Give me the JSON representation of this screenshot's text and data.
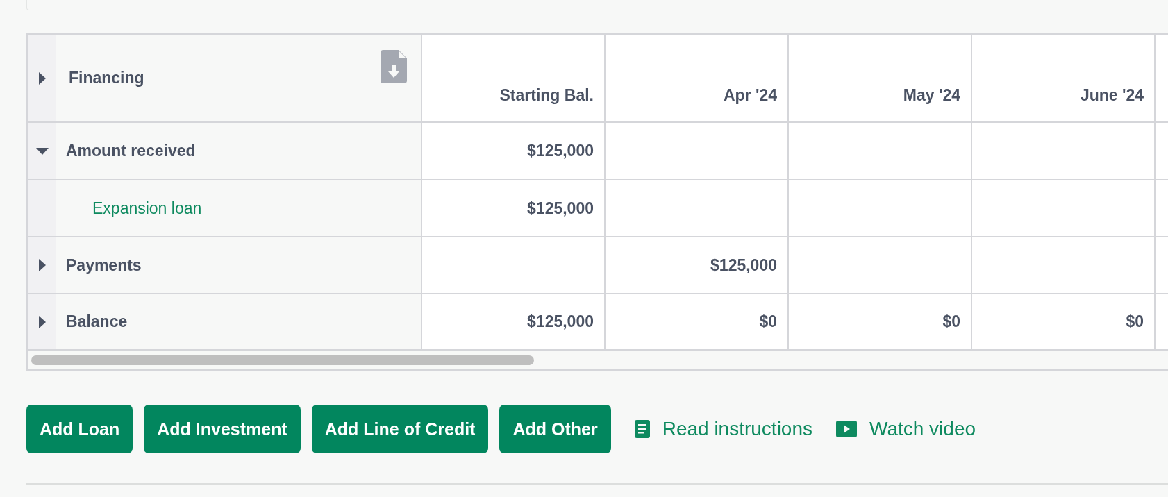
{
  "table": {
    "header": {
      "label": "Financing",
      "expanded": false,
      "columns": [
        "Starting Bal.",
        "Apr '24",
        "May '24",
        "June '24"
      ]
    },
    "rows": [
      {
        "kind": "group",
        "label": "Amount received",
        "expanded": true,
        "cells": [
          "$125,000",
          null,
          null,
          null
        ]
      },
      {
        "kind": "child",
        "label": "Expansion loan",
        "cells": [
          "$125,000",
          null,
          null,
          null
        ]
      },
      {
        "kind": "group",
        "label": "Payments",
        "expanded": false,
        "cells": [
          null,
          "$125,000",
          null,
          null
        ]
      },
      {
        "kind": "group",
        "label": "Balance",
        "expanded": false,
        "cells": [
          "$125,000",
          "$0",
          "$0",
          "$0"
        ]
      }
    ]
  },
  "buttons": [
    "Add Loan",
    "Add Investment",
    "Add Line of Credit",
    "Add Other"
  ],
  "links": [
    {
      "kind": "instructions",
      "label": "Read instructions"
    },
    {
      "kind": "video",
      "label": "Watch video"
    }
  ]
}
